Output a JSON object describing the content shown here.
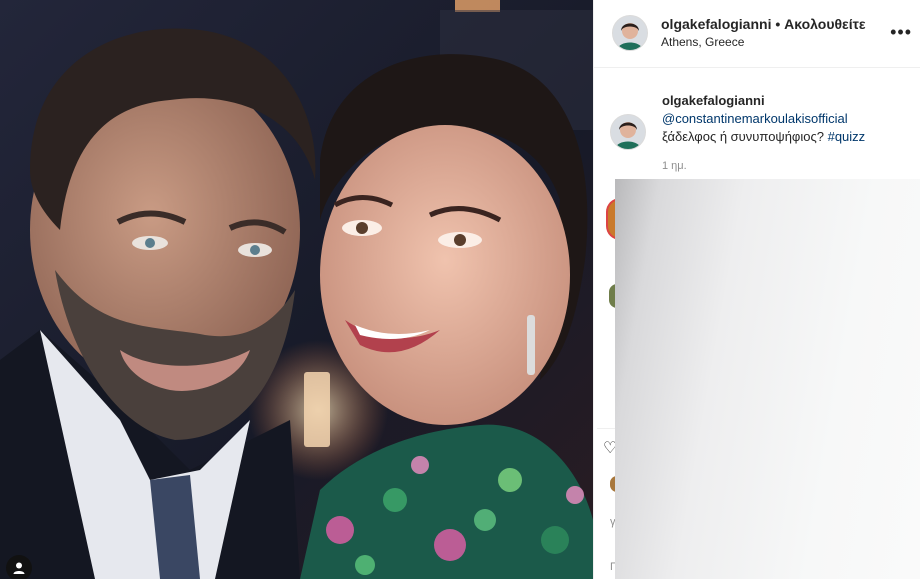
{
  "post": {
    "username": "olgakefalogianni",
    "separator": "•",
    "follow_label": "Ακολουθείτε",
    "location": "Athens, Greece",
    "more_label": "•••"
  },
  "caption": {
    "username": "olgakefalogianni",
    "mention": "@constantinemarkoulakisofficial",
    "text": "ξάδελφος ή συνυποψήφιος?",
    "hashtag": "#quizz",
    "time": "1 ημ."
  },
  "side": {
    "truncated_1": "γ",
    "truncated_2": "Γ"
  },
  "icons": {
    "tag_user": "user-tag-icon",
    "more": "more-options-icon",
    "like": "heart-icon"
  },
  "colors": {
    "link": "#00376b",
    "text": "#262626",
    "muted": "#8e8e8e",
    "border": "#efefef"
  }
}
